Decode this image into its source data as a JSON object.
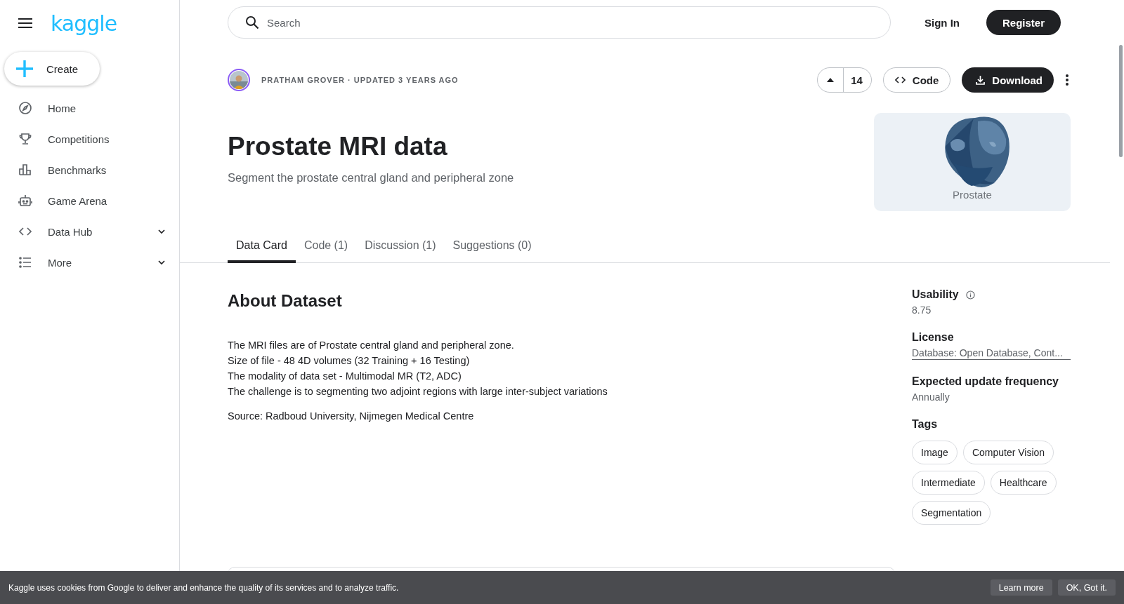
{
  "logo": "kaggle",
  "create": {
    "label": "Create"
  },
  "sidebar": {
    "items": [
      {
        "label": "Home",
        "kind": "home",
        "expandable": false
      },
      {
        "label": "Competitions",
        "kind": "trophy",
        "expandable": false
      },
      {
        "label": "Benchmarks",
        "kind": "bars",
        "expandable": false
      },
      {
        "label": "Game Arena",
        "kind": "robot",
        "expandable": false
      },
      {
        "label": "Data Hub",
        "kind": "code",
        "expandable": true
      },
      {
        "label": "More",
        "kind": "list",
        "expandable": true
      }
    ]
  },
  "search": {
    "placeholder": "Search"
  },
  "auth": {
    "sign_in": "Sign In",
    "register": "Register"
  },
  "dataset": {
    "byline": "PRATHAM GROVER · UPDATED 3 YEARS AGO",
    "votes": "14",
    "code_button": "Code",
    "download_button": "Download",
    "title": "Prostate MRI data",
    "subtitle": "Segment the prostate central gland and peripheral zone",
    "thumbnail_caption": "Prostate"
  },
  "tabs": [
    {
      "label": "Data Card",
      "selected": true
    },
    {
      "label": "Code (1)",
      "selected": false
    },
    {
      "label": "Discussion (1)",
      "selected": false
    },
    {
      "label": "Suggestions (0)",
      "selected": false
    }
  ],
  "about": {
    "heading": "About Dataset",
    "lines": [
      "The MRI files are of Prostate central gland and peripheral zone.",
      "Size of file - 48 4D volumes (32 Training + 16 Testing)",
      "The modality of data set - Multimodal MR (T2, ADC)",
      "The challenge is to segmenting two adjoint regions with large inter-subject variations"
    ],
    "source": "Source: Radboud University, Nijmegen Medical Centre"
  },
  "meta": {
    "usability_label": "Usability",
    "usability": "8.75",
    "license_label": "License",
    "license": "Database: Open Database, Cont...",
    "frequency_label": "Expected update frequency",
    "frequency": "Annually",
    "tags_label": "Tags",
    "tags": [
      "Image",
      "Computer Vision",
      "Intermediate",
      "Healthcare",
      "Segmentation"
    ]
  },
  "cookie_bar": {
    "text": "Kaggle uses cookies from Google to deliver and enhance the quality of its services and to analyze traffic.",
    "learn_more": "Learn more",
    "ok": "OK, Got it."
  }
}
